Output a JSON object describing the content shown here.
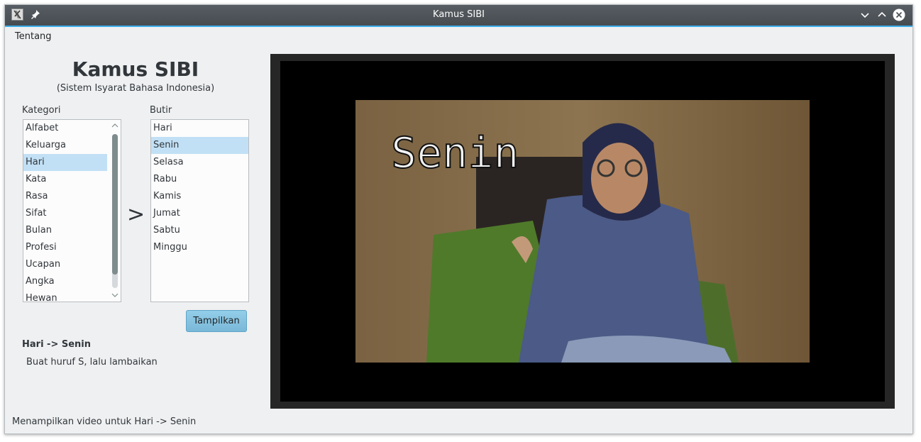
{
  "window": {
    "title": "Kamus SIBI"
  },
  "menu": {
    "items": [
      "Tentang"
    ]
  },
  "header": {
    "title": "Kamus SIBI",
    "subtitle": "(Sistem Isyarat Bahasa Indonesia)"
  },
  "kategori": {
    "label": "Kategori",
    "items": [
      "Alfabet",
      "Keluarga",
      "Hari",
      "Kata",
      "Rasa",
      "Sifat",
      "Bulan",
      "Profesi",
      "Ucapan",
      "Angka",
      "Hewan"
    ],
    "selected": "Hari"
  },
  "separator": ">",
  "butir": {
    "label": "Butir",
    "items": [
      "Hari",
      "Senin",
      "Selasa",
      "Rabu",
      "Kamis",
      "Jumat",
      "Sabtu",
      "Minggu"
    ],
    "selected": "Senin"
  },
  "actions": {
    "show_label": "Tampilkan"
  },
  "detail": {
    "path": "Hari -> Senin",
    "description": "Buat huruf S, lalu lambaikan"
  },
  "video": {
    "caption": "Senin"
  },
  "status": "Menampilkan video untuk Hari -> Senin",
  "colors": {
    "accent": "#3daee9",
    "selection": "#c2e0f5",
    "button": "#93cee9"
  },
  "icons": {
    "app": "app-icon",
    "pin": "pin-icon",
    "minimize": "chevron-down-icon",
    "maximize": "chevron-up-icon",
    "close": "close-icon",
    "scroll_up": "chevron-up-icon",
    "scroll_down": "chevron-down-icon"
  }
}
